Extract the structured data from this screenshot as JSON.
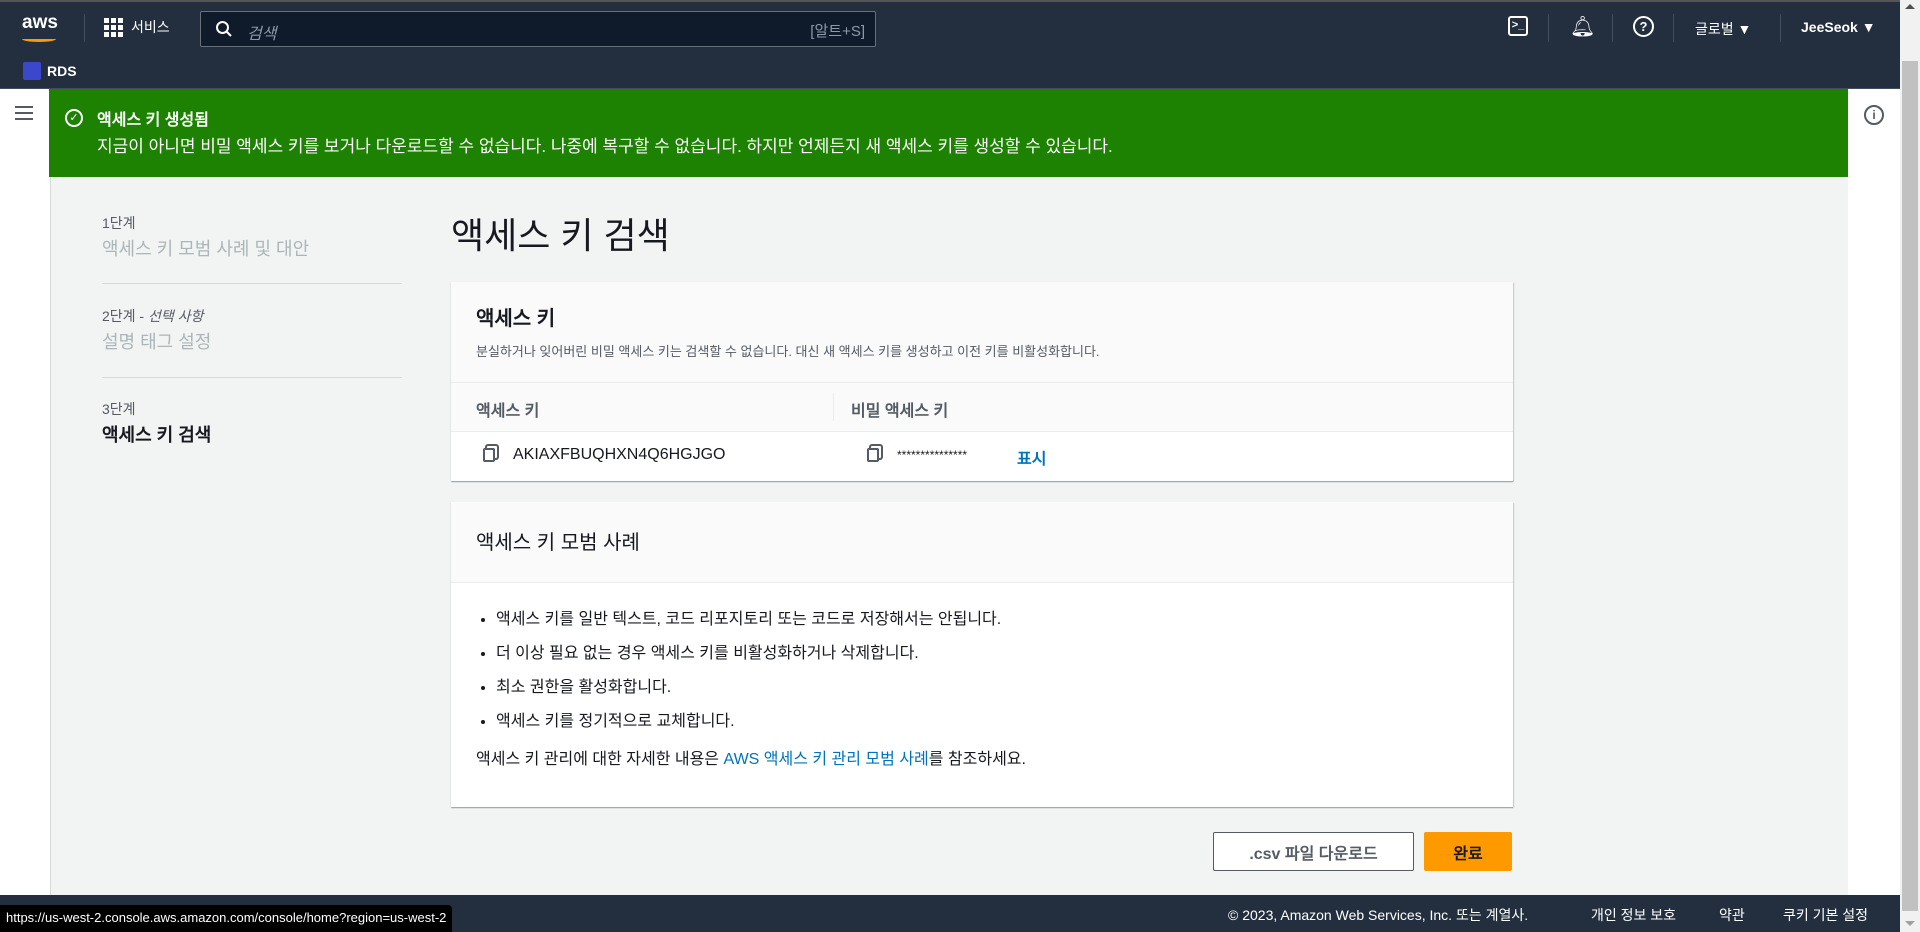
{
  "nav": {
    "services": "서비스",
    "search_placeholder": "검색",
    "search_shortcut": "[알트+S]",
    "region": "글로벌 ▼",
    "user": "JeeSeok ▼",
    "logo_text": "aws",
    "service_shortcut": "RDS"
  },
  "banner": {
    "title": "액세스 키 생성됨",
    "message": "지금이 아니면 비밀 액세스 키를 보거나 다운로드할 수 없습니다. 나중에 복구할 수 없습니다. 하지만 언제든지 새 액세스 키를 생성할 수 있습니다."
  },
  "steps": [
    {
      "step": "1단계",
      "label": "액세스 키 모범 사례 및 대안"
    },
    {
      "step": "2단계 -",
      "optional": "선택 사항",
      "label": "설명 태그 설정"
    },
    {
      "step": "3단계",
      "label": "액세스 키 검색"
    }
  ],
  "page_title": "액세스 키 검색",
  "keys_card": {
    "title": "액세스 키",
    "description": "분실하거나 잊어버린 비밀 액세스 키는 검색할 수 없습니다. 대신 새 액세스 키를 생성하고 이전 키를 비활성화합니다.",
    "col_access": "액세스 키",
    "col_secret": "비밀 액세스 키",
    "access_key": "AKIAXFBUQHXN4Q6HGJGO",
    "secret_masked": "***************",
    "show": "표시"
  },
  "practices_card": {
    "title": "액세스 키 모범 사례",
    "items": [
      "액세스 키를 일반 텍스트, 코드 리포지토리 또는 코드로 저장해서는 안됩니다.",
      "더 이상 필요 없는 경우 액세스 키를 비활성화하거나 삭제합니다.",
      "최소 권한을 활성화합니다.",
      "액세스 키를 정기적으로 교체합니다."
    ],
    "more_prefix": "액세스 키 관리에 대한 자세한 내용은 ",
    "more_link": "AWS 액세스 키 관리 모범 사례",
    "more_suffix": "를 참조하세요."
  },
  "buttons": {
    "download_csv": ".csv 파일 다운로드",
    "done": "완료"
  },
  "footer": {
    "copyright": "© 2023, Amazon Web Services, Inc. 또는 계열사.",
    "privacy": "개인 정보 보호",
    "terms": "약관",
    "cookies": "쿠키 기본 설정"
  },
  "status_url": "https://us-west-2.console.aws.amazon.com/console/home?region=us-west-2",
  "colors": {
    "nav": "#232f3e",
    "success": "#1d8102",
    "primary": "#ff9900",
    "link": "#0073bb"
  }
}
